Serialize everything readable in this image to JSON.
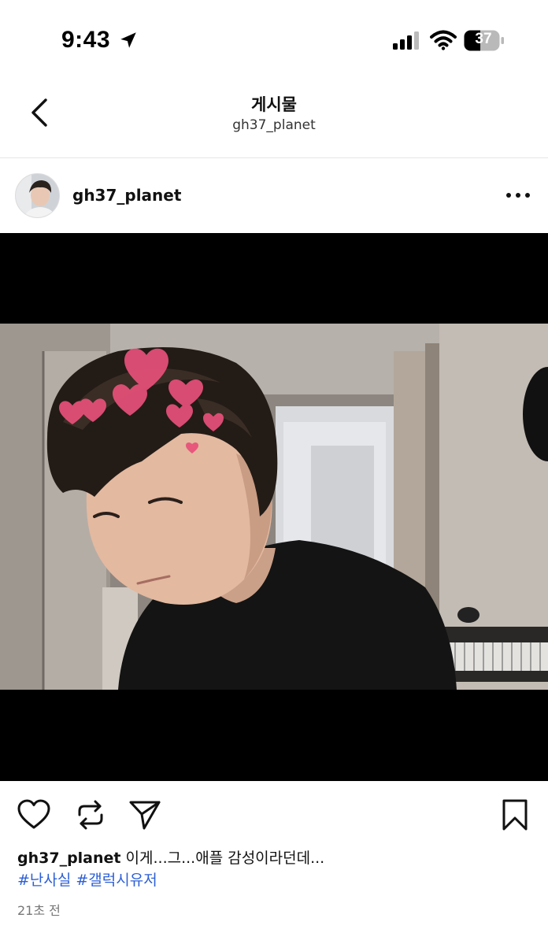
{
  "status_bar": {
    "time": "9:43",
    "battery": "37"
  },
  "header": {
    "title": "게시물",
    "subtitle": "gh37_planet"
  },
  "post": {
    "author": "gh37_planet",
    "caption_user": "gh37_planet",
    "caption_text": " 이게...그...애플 감성이라던데...",
    "hashtags": [
      "#난사실",
      "#갤럭시유저"
    ],
    "timestamp": "21초 전"
  },
  "icons": {
    "back": "chevron-left-icon",
    "more": "more-dots-icon",
    "like": "heart-icon",
    "repost": "repost-icon",
    "share": "send-icon",
    "save": "bookmark-icon"
  },
  "colors": {
    "hashtag": "#2d5fd6",
    "heart_sticker": "#e8507a"
  }
}
